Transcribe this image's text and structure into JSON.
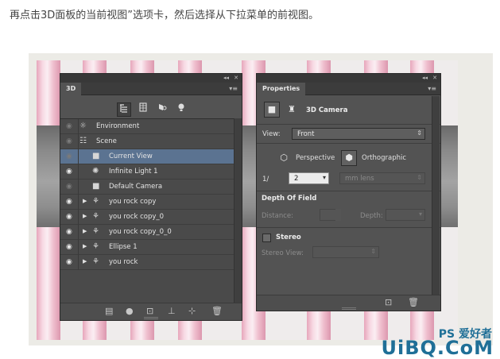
{
  "caption": "再点击3D面板的当前视图”选项卡，然后选择从下拉菜单的前视图。",
  "watermark": {
    "line1": "PS 爱好者",
    "line2": "UiBQ.CoM"
  },
  "panel_3d": {
    "tab": "3D",
    "collapse_glyph": "◂◂",
    "close_glyph": "✕",
    "menu_glyph": "▾≡",
    "filter_icons": [
      "scene-filter-icon",
      "mesh-filter-icon",
      "material-filter-icon",
      "light-filter-icon"
    ],
    "rows": [
      {
        "label": "Environment",
        "visible": false,
        "icon": "environment-icon"
      },
      {
        "label": "Scene",
        "visible": false,
        "icon": "scene-icon"
      },
      {
        "label": "Current View",
        "visible": false,
        "icon": "camera-icon",
        "selected": true
      },
      {
        "label": "Infinite Light 1",
        "visible": true,
        "icon": "light-icon"
      },
      {
        "label": "Default Camera",
        "visible": false,
        "icon": "camera-icon"
      },
      {
        "label": "you rock copy",
        "visible": true,
        "icon": "mesh-icon",
        "expandable": true
      },
      {
        "label": "you rock copy_0",
        "visible": true,
        "icon": "mesh-icon",
        "expandable": true
      },
      {
        "label": "you rock copy_0_0",
        "visible": true,
        "icon": "mesh-icon",
        "expandable": true
      },
      {
        "label": "Ellipse 1",
        "visible": true,
        "icon": "mesh-icon",
        "expandable": true
      },
      {
        "label": "you rock",
        "visible": true,
        "icon": "mesh-icon",
        "expandable": true
      }
    ],
    "bottom_icons": [
      "render-settings-icon",
      "add-light-icon",
      "add-mesh-icon",
      "ground-icon",
      "light-direction-icon",
      "trash-icon"
    ]
  },
  "panel_properties": {
    "tab": "Properties",
    "collapse_glyph": "◂◂",
    "close_glyph": "✕",
    "menu_glyph": "▾≡",
    "title": "3D Camera",
    "view_label": "View:",
    "view_value": "Front",
    "perspective_label": "Perspective",
    "orthographic_label": "Orthographic",
    "zoom_prefix": "1/",
    "zoom_value": "2",
    "lens_value": "mm lens",
    "dof_title": "Depth Of Field",
    "distance_label": "Distance:",
    "depth_label": "Depth:",
    "stereo_label": "Stereo",
    "stereo_view_label": "Stereo View:",
    "bottom_icons": [
      "camera-view-icon",
      "trash-icon"
    ]
  }
}
